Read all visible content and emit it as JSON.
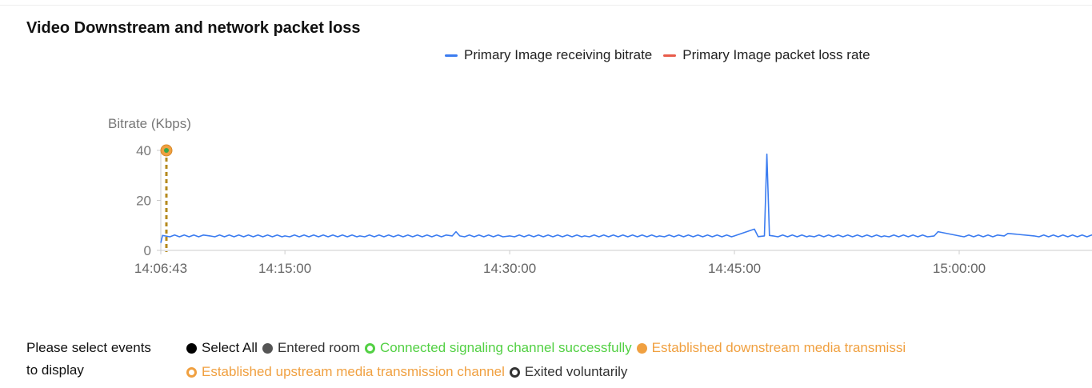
{
  "title": "Video Downstream and network packet loss",
  "legend": [
    {
      "label": "Primary Image receiving bitrate",
      "color": "#3b7cf0"
    },
    {
      "label": "Primary Image packet loss rate",
      "color": "#e85b4a"
    }
  ],
  "chart_data": {
    "type": "line",
    "title": "Video Downstream and network packet loss",
    "ylabel": "Bitrate (Kbps)",
    "xlabel": "",
    "ylim": [
      0,
      40
    ],
    "yticks": [
      "0",
      "20",
      "40"
    ],
    "xticks": [
      "14:06:43",
      "14:15:00",
      "14:30:00",
      "14:45:00",
      "15:00:00"
    ],
    "grid": false,
    "legend_position": "top",
    "series": [
      {
        "name": "Primary Image receiving bitrate",
        "color": "#3b7cf0",
        "x": [
          "14:06:43",
          "14:06:50",
          "14:07:00",
          "14:10:00",
          "14:15:00",
          "14:20:00",
          "14:26:10",
          "14:26:25",
          "14:26:40",
          "14:30:00",
          "14:35:00",
          "14:40:00",
          "14:45:00",
          "14:46:20",
          "14:46:35",
          "14:47:00",
          "14:47:10",
          "14:47:20",
          "14:47:35",
          "14:50:00",
          "14:55:00",
          "14:58:20",
          "14:58:35",
          "15:00:00",
          "15:03:00",
          "15:03:15",
          "15:05:00",
          "15:10:00"
        ],
        "values": [
          3,
          6,
          5.8,
          5.8,
          5.8,
          5.8,
          5.8,
          7.5,
          5.8,
          5.8,
          5.8,
          5.8,
          5.8,
          8.5,
          5.5,
          5.8,
          38.5,
          6,
          5.8,
          5.8,
          5.8,
          5.8,
          7.5,
          5.8,
          5.8,
          6.8,
          5.8,
          5.8
        ]
      },
      {
        "name": "Primary Image packet loss rate",
        "color": "#e85b4a",
        "x": [],
        "values": []
      }
    ],
    "event_markers": [
      {
        "time": "14:06:43",
        "color": "#f0a040",
        "line_style": "dashed",
        "line_color": "#b58a1e"
      }
    ]
  },
  "events": {
    "label_line1": "Please select events",
    "label_line2": "to display",
    "row1": [
      {
        "label": "Select All",
        "color": "#000000",
        "style": "filled",
        "text_color": "#111111"
      },
      {
        "label": "Entered room",
        "color": "#555555",
        "style": "filled",
        "text_color": "#333333"
      },
      {
        "label": "Connected signaling channel successfully",
        "color": "#52d043",
        "style": "hollow",
        "text_color": "#52d043"
      },
      {
        "label": "Established downstream media transmissi",
        "color": "#f0a040",
        "style": "filled",
        "text_color": "#f0a040"
      }
    ],
    "row2": [
      {
        "label": "Established upstream media transmission channel",
        "color": "#f0a040",
        "style": "hollow",
        "text_color": "#f0a040"
      },
      {
        "label": "Exited voluntarily",
        "color": "#333333",
        "style": "hollow",
        "text_color": "#333333"
      }
    ]
  }
}
